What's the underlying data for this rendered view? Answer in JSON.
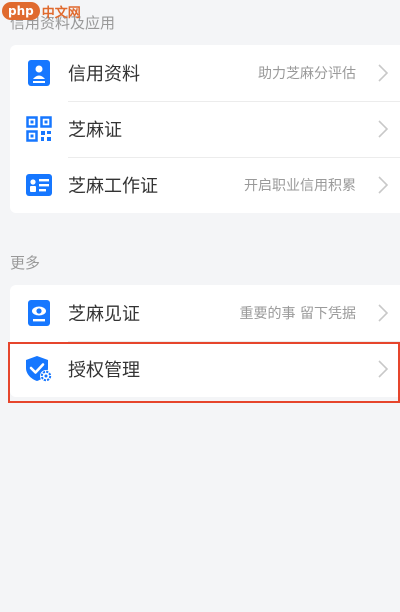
{
  "watermark": {
    "logo": "php",
    "text": "中文网"
  },
  "sections": {
    "credit": {
      "title": "信用资料及应用",
      "items": [
        {
          "label": "信用资料",
          "desc": "助力芝麻分评估",
          "icon": "credit-profile-icon"
        },
        {
          "label": "芝麻证",
          "desc": "",
          "icon": "qr-code-icon"
        },
        {
          "label": "芝麻工作证",
          "desc": "开启职业信用积累",
          "icon": "work-badge-icon"
        }
      ]
    },
    "more": {
      "title": "更多",
      "items": [
        {
          "label": "芝麻见证",
          "desc": "重要的事 留下凭据",
          "icon": "witness-icon"
        },
        {
          "label": "授权管理",
          "desc": "",
          "icon": "shield-settings-icon"
        }
      ]
    }
  },
  "colors": {
    "accent": "#1677ff",
    "highlight_border": "#e6452c",
    "background": "#f4f5f7",
    "watermark": "#e06a2e"
  }
}
